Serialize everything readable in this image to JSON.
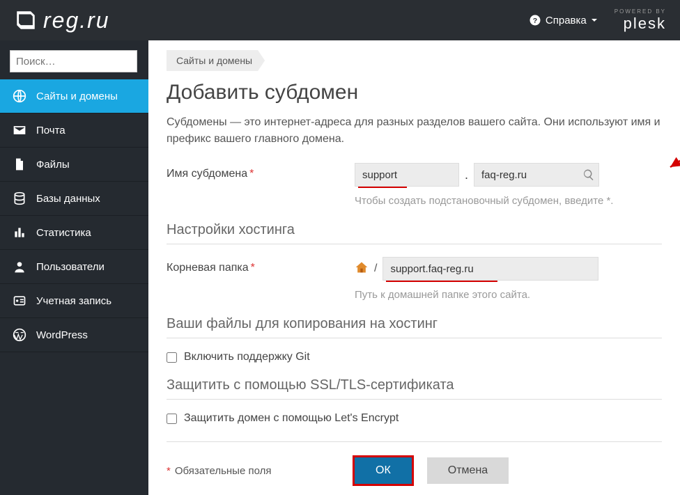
{
  "header": {
    "logo_text": "reg.ru",
    "help_label": "Справка",
    "powered_small": "POWERED BY",
    "powered_brand": "plesk"
  },
  "sidebar": {
    "search_placeholder": "Поиск…",
    "items": [
      {
        "label": "Сайты и домены",
        "active": true
      },
      {
        "label": "Почта",
        "active": false
      },
      {
        "label": "Файлы",
        "active": false
      },
      {
        "label": "Базы данных",
        "active": false
      },
      {
        "label": "Статистика",
        "active": false
      },
      {
        "label": "Пользователи",
        "active": false
      },
      {
        "label": "Учетная запись",
        "active": false
      },
      {
        "label": "WordPress",
        "active": false
      }
    ]
  },
  "main": {
    "breadcrumb": "Сайты и домены",
    "title": "Добавить субдомен",
    "description": "Субдомены — это интернет-адреса для разных разделов вашего сайта. Они используют имя и префикс вашего главного домена.",
    "subdomain_label": "Имя субдомена",
    "subdomain_value": "support",
    "domain_value": "faq-reg.ru",
    "subdomain_hint": "Чтобы создать подстановочный субдомен, введите *.",
    "hosting_section": "Настройки хостинга",
    "root_label": "Корневая папка",
    "root_value": "support.faq-reg.ru",
    "root_hint": "Путь к домашней папке этого сайта.",
    "files_section": "Ваши файлы для копирования на хостинг",
    "git_label": "Включить поддержку Git",
    "ssl_section": "Защитить с помощью SSL/TLS-сертификата",
    "letsencrypt_label": "Защитить домен с помощью Let's Encrypt",
    "mandatory_label": "Обязательные поля",
    "ok_label": "ОК",
    "cancel_label": "Отмена"
  },
  "colors": {
    "accent": "#1aa7e1",
    "highlight": "#d40000",
    "header_bg": "#2a2e33"
  }
}
